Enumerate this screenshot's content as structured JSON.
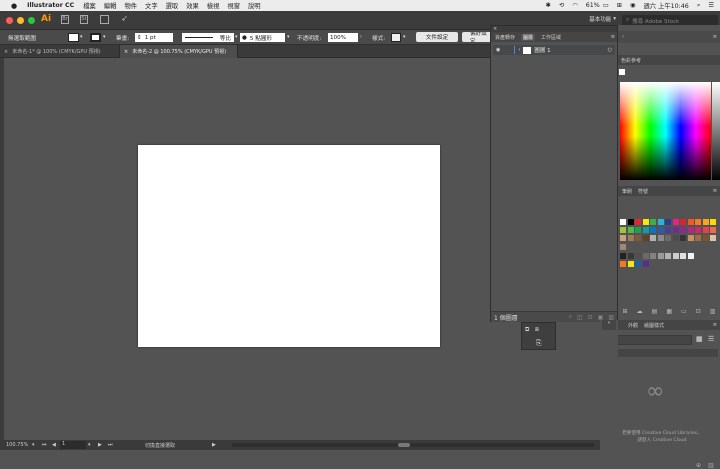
{
  "menubar": {
    "app_name": "Illustrator CC",
    "items": [
      "檔案",
      "編輯",
      "物件",
      "文字",
      "選取",
      "效果",
      "檢視",
      "視窗",
      "說明"
    ],
    "battery": "61%",
    "clock": "週六 上午10:46"
  },
  "appbar": {
    "workspace": "基本功能",
    "search_placeholder": "搜尋 Adobe Stock"
  },
  "control": {
    "selection": "無選取範圍",
    "stroke_label": "筆畫:",
    "stroke_value": "1 pt",
    "stroke_profile": "等比",
    "brush": "5 點圓形",
    "opacity_label": "不透明度:",
    "opacity_value": "100%",
    "style_label": "樣式:",
    "doc_setup": "文件設定",
    "preferences": "偏好設定"
  },
  "tabs": [
    {
      "label": "未命名-1* @ 100% (CMYK/GPU 預視)"
    },
    {
      "label": "未命名-2 @ 100.75% (CMYK/GPU 預視)"
    }
  ],
  "layers_panel": {
    "tabs": [
      "資產轉存",
      "圖層",
      "工作區域"
    ],
    "layer_name": "圖層 1",
    "footer": "1 個圖層"
  },
  "right_panels": {
    "color_guide": "色彩參考",
    "swatch_tabs": [
      "筆刷",
      "符號"
    ],
    "library_tabs": [
      "外觀",
      "繪圖樣式"
    ],
    "cc_msg_1": "若要使用 Creative Cloud Libraries，",
    "cc_msg_2": "請登入 Creative Cloud"
  },
  "status": {
    "zoom": "100.75%",
    "page": "1",
    "tool": "切換直接選取"
  },
  "colors": {
    "menubar_bg": "#ececec",
    "workspace_bg": "#535353",
    "artboard": "#ffffff",
    "panel_bg": "#535353",
    "accent": "#3b8eea"
  }
}
